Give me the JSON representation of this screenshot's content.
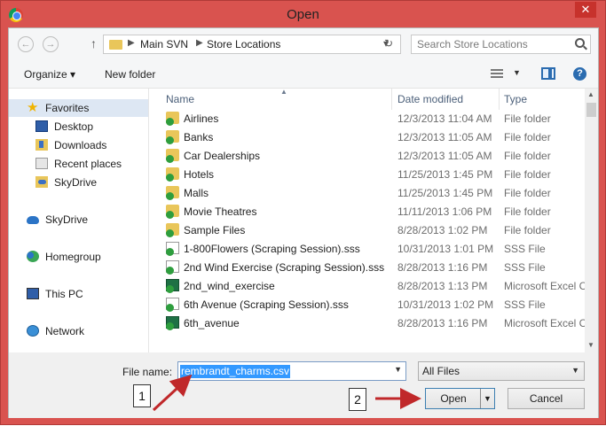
{
  "window": {
    "title": "Open",
    "close_glyph": "✕"
  },
  "address": {
    "back_glyph": "←",
    "forward_glyph": "→",
    "up_glyph": "↑",
    "crumbs": [
      "Main SVN",
      "Store Locations"
    ],
    "crumb_sep": "▶",
    "dropdown_glyph": "▾",
    "refresh_glyph": "↻",
    "search_placeholder": "Search Store Locations"
  },
  "toolbar": {
    "organize": "Organize ▾",
    "new_folder": "New folder",
    "help": "?",
    "view_caret": "▼"
  },
  "nav": {
    "items": [
      {
        "label": "Favorites",
        "icon": "star-icon"
      },
      {
        "label": "Desktop",
        "icon": "desktop-icon"
      },
      {
        "label": "Downloads",
        "icon": "downloads-icon"
      },
      {
        "label": "Recent places",
        "icon": "recent-places-icon"
      },
      {
        "label": "SkyDrive",
        "icon": "skydrive-folder-icon"
      },
      {
        "label": "SkyDrive",
        "icon": "cloud-icon"
      },
      {
        "label": "Homegroup",
        "icon": "homegroup-icon"
      },
      {
        "label": "This PC",
        "icon": "computer-icon"
      },
      {
        "label": "Network",
        "icon": "network-icon"
      }
    ],
    "star_glyph": "★"
  },
  "columns": {
    "name": "Name",
    "date": "Date modified",
    "type": "Type",
    "sort_glyph": "▲"
  },
  "files": [
    {
      "name": "Airlines",
      "date": "12/3/2013 11:04 AM",
      "type": "File folder",
      "kind": "folder"
    },
    {
      "name": "Banks",
      "date": "12/3/2013 11:05 AM",
      "type": "File folder",
      "kind": "folder"
    },
    {
      "name": "Car Dealerships",
      "date": "12/3/2013 11:05 AM",
      "type": "File folder",
      "kind": "folder"
    },
    {
      "name": "Hotels",
      "date": "11/25/2013 1:45 PM",
      "type": "File folder",
      "kind": "folder"
    },
    {
      "name": "Malls",
      "date": "11/25/2013 1:45 PM",
      "type": "File folder",
      "kind": "folder"
    },
    {
      "name": "Movie Theatres",
      "date": "11/11/2013 1:06 PM",
      "type": "File folder",
      "kind": "folder"
    },
    {
      "name": "Sample Files",
      "date": "8/28/2013 1:02 PM",
      "type": "File folder",
      "kind": "folder"
    },
    {
      "name": "1-800Flowers (Scraping Session).sss",
      "date": "10/31/2013 1:01 PM",
      "type": "SSS File",
      "kind": "file"
    },
    {
      "name": "2nd Wind Exercise (Scraping Session).sss",
      "date": "8/28/2013 1:16 PM",
      "type": "SSS File",
      "kind": "file"
    },
    {
      "name": "2nd_wind_exercise",
      "date": "8/28/2013 1:13 PM",
      "type": "Microsoft Excel C",
      "kind": "excel"
    },
    {
      "name": "6th Avenue (Scraping Session).sss",
      "date": "10/31/2013 1:02 PM",
      "type": "SSS File",
      "kind": "file"
    },
    {
      "name": "6th_avenue",
      "date": "8/28/2013 1:16 PM",
      "type": "Microsoft Excel C",
      "kind": "excel"
    }
  ],
  "scroll": {
    "up_glyph": "▲",
    "down_glyph": "▼"
  },
  "bottom": {
    "file_name_label": "File name:",
    "file_name_value": "rembrandt_charms.csv",
    "filter_value": "All Files",
    "dropdown_glyph": "▼",
    "open_label": "Open",
    "cancel_label": "Cancel"
  },
  "annotations": {
    "callout_1": "1",
    "callout_2": "2",
    "arrow_color": "#c0282a"
  }
}
